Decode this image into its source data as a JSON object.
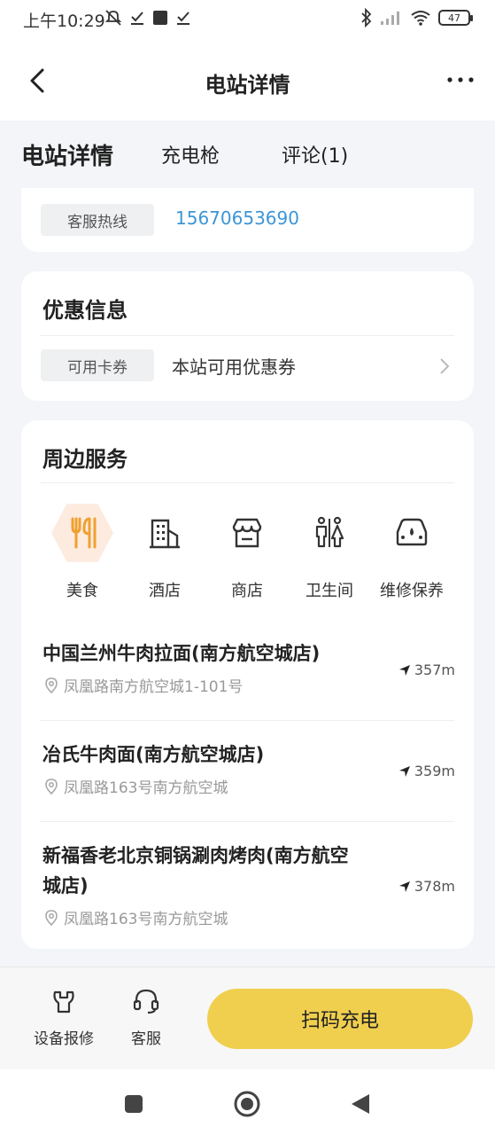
{
  "status_bar": {
    "time": "上午10:29",
    "battery": "47"
  },
  "header": {
    "title": "电站详情"
  },
  "tabs": [
    {
      "label": "电站详情"
    },
    {
      "label": "充电枪"
    },
    {
      "label": "评论(1)"
    }
  ],
  "hotline": {
    "tag": "客服热线",
    "number": "15670653690"
  },
  "offer": {
    "title": "优惠信息",
    "tag": "可用卡券",
    "text": "本站可用优惠券"
  },
  "nearby": {
    "title": "周边服务",
    "services": [
      {
        "label": "美食",
        "icon": "food-icon",
        "active": true
      },
      {
        "label": "酒店",
        "icon": "hotel-icon"
      },
      {
        "label": "商店",
        "icon": "store-icon"
      },
      {
        "label": "卫生间",
        "icon": "toilet-icon"
      },
      {
        "label": "维修保养",
        "icon": "car-repair-icon"
      }
    ],
    "places": [
      {
        "name": "中国兰州牛肉拉面(南方航空城店)",
        "address": "凤凰路南方航空城1-101号",
        "distance": "357m"
      },
      {
        "name": "冶氏牛肉面(南方航空城店)",
        "address": "凤凰路163号南方航空城",
        "distance": "359m"
      },
      {
        "name": "新福香老北京铜锅涮肉烤肉(南方航空城店)",
        "address": "凤凰路163号南方航空城",
        "distance": "378m"
      }
    ]
  },
  "bottom_bar": {
    "repair_label": "设备报修",
    "service_label": "客服",
    "scan_label": "扫码充电"
  },
  "colors": {
    "accent": "#f0cf4f",
    "link": "#3d95d6",
    "food_icon": "#f0a030"
  }
}
